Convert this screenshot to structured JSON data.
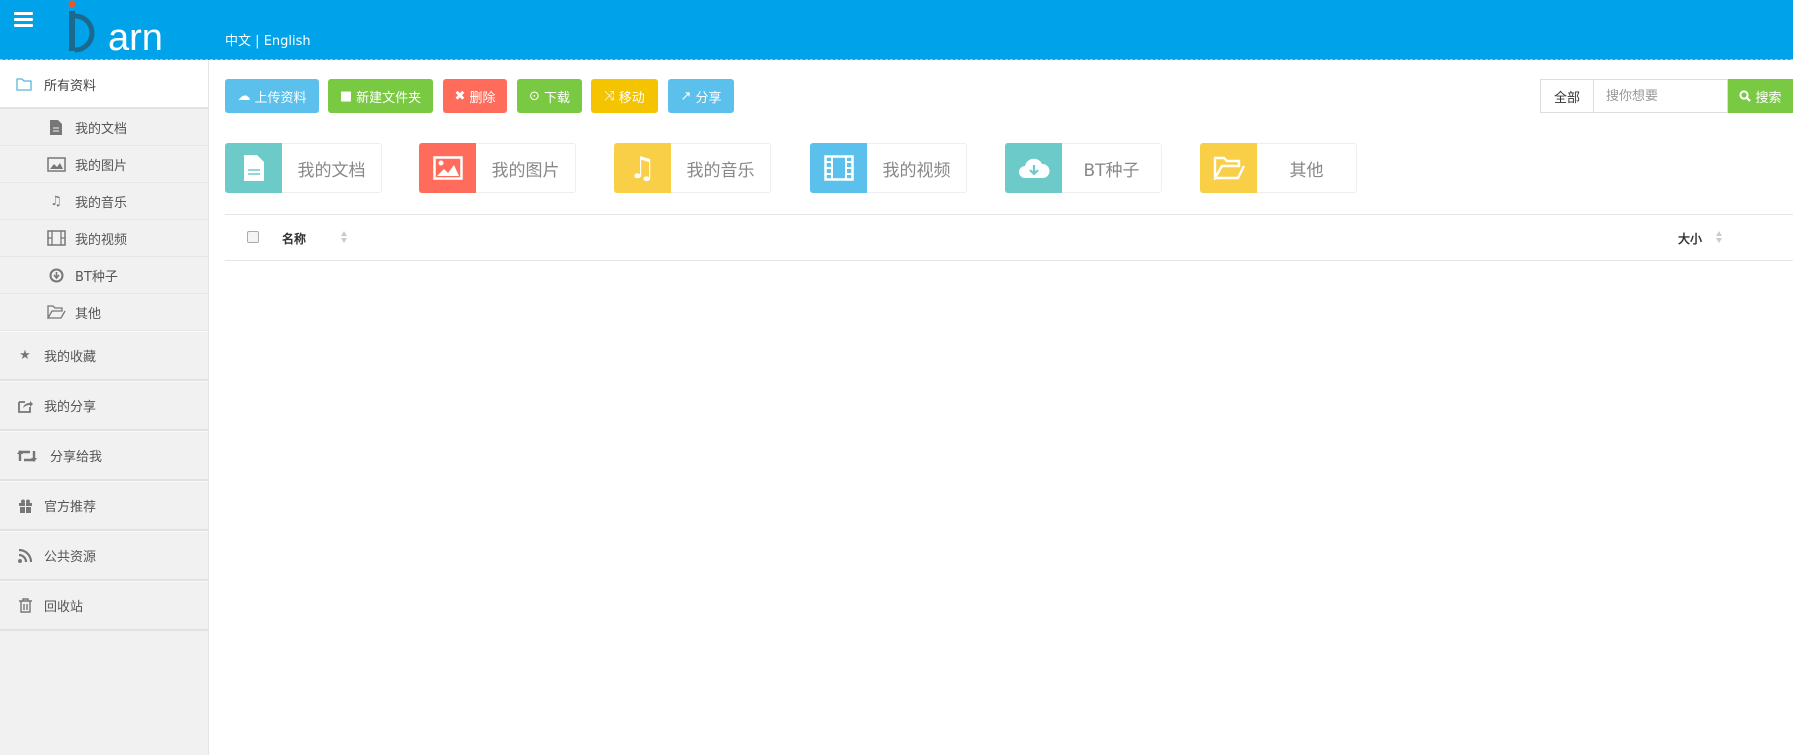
{
  "header": {
    "logo_text": "iBarn",
    "lang_zh": "中文",
    "lang_sep": "|",
    "lang_en": "English"
  },
  "sidebar": {
    "top": {
      "label": "所有资料",
      "icon": "folder-icon"
    },
    "sub_items": [
      {
        "label": "我的文档",
        "icon": "file-icon"
      },
      {
        "label": "我的图片",
        "icon": "image-icon"
      },
      {
        "label": "我的音乐",
        "icon": "music-icon"
      },
      {
        "label": "我的视频",
        "icon": "film-icon"
      },
      {
        "label": "BT种子",
        "icon": "download-circle-icon"
      },
      {
        "label": "其他",
        "icon": "folder-open-icon"
      }
    ],
    "items": [
      {
        "label": "我的收藏",
        "icon": "star-icon"
      },
      {
        "label": "我的分享",
        "icon": "share-icon"
      },
      {
        "label": "分享给我",
        "icon": "retweet-icon"
      },
      {
        "label": "官方推荐",
        "icon": "gift-icon"
      },
      {
        "label": "公共资源",
        "icon": "rss-icon"
      },
      {
        "label": "回收站",
        "icon": "trash-icon"
      }
    ]
  },
  "toolbar": {
    "upload": "上传资料",
    "new_folder": "新建文件夹",
    "delete": "删除",
    "download": "下载",
    "move": "移动",
    "share": "分享"
  },
  "colors": {
    "header": "#00a3e9",
    "blue": "#5bc0eb",
    "green": "#7ac943",
    "red": "#ff6c5c",
    "yellow": "#f5c400",
    "teal": "#6ccac9",
    "cardyellow": "#f9cf47"
  },
  "categories": [
    {
      "label": "我的文档"
    },
    {
      "label": "我的图片"
    },
    {
      "label": "我的音乐"
    },
    {
      "label": "我的视频"
    },
    {
      "label": "BT种子"
    },
    {
      "label": "其他"
    }
  ],
  "search": {
    "scope": "全部",
    "placeholder": "搜你想要",
    "button": "搜索"
  },
  "table": {
    "col_name": "名称",
    "col_size": "大小"
  }
}
